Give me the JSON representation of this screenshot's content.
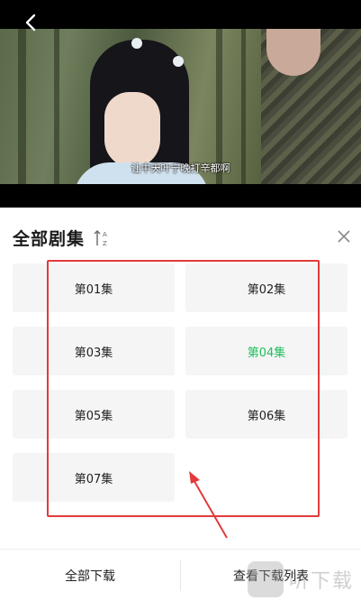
{
  "video": {
    "subtitle": "让中天叶宁晚打辛都啊",
    "back_icon": "back-chevron-icon"
  },
  "panel": {
    "title": "全部剧集",
    "sort_icon": "sort-az-icon",
    "close_icon": "close-icon"
  },
  "episodes": [
    {
      "label": "第01集",
      "active": false
    },
    {
      "label": "第02集",
      "active": false
    },
    {
      "label": "第03集",
      "active": false
    },
    {
      "label": "第04集",
      "active": true
    },
    {
      "label": "第05集",
      "active": false
    },
    {
      "label": "第06集",
      "active": false
    },
    {
      "label": "第07集",
      "active": false
    }
  ],
  "colors": {
    "active_episode": "#1fbf5a",
    "annotation": "#e23b3b"
  },
  "bottom_bar": {
    "download_all": "全部下载",
    "view_download_list": "查看下载列表"
  },
  "watermark": {
    "text": "听下载"
  }
}
